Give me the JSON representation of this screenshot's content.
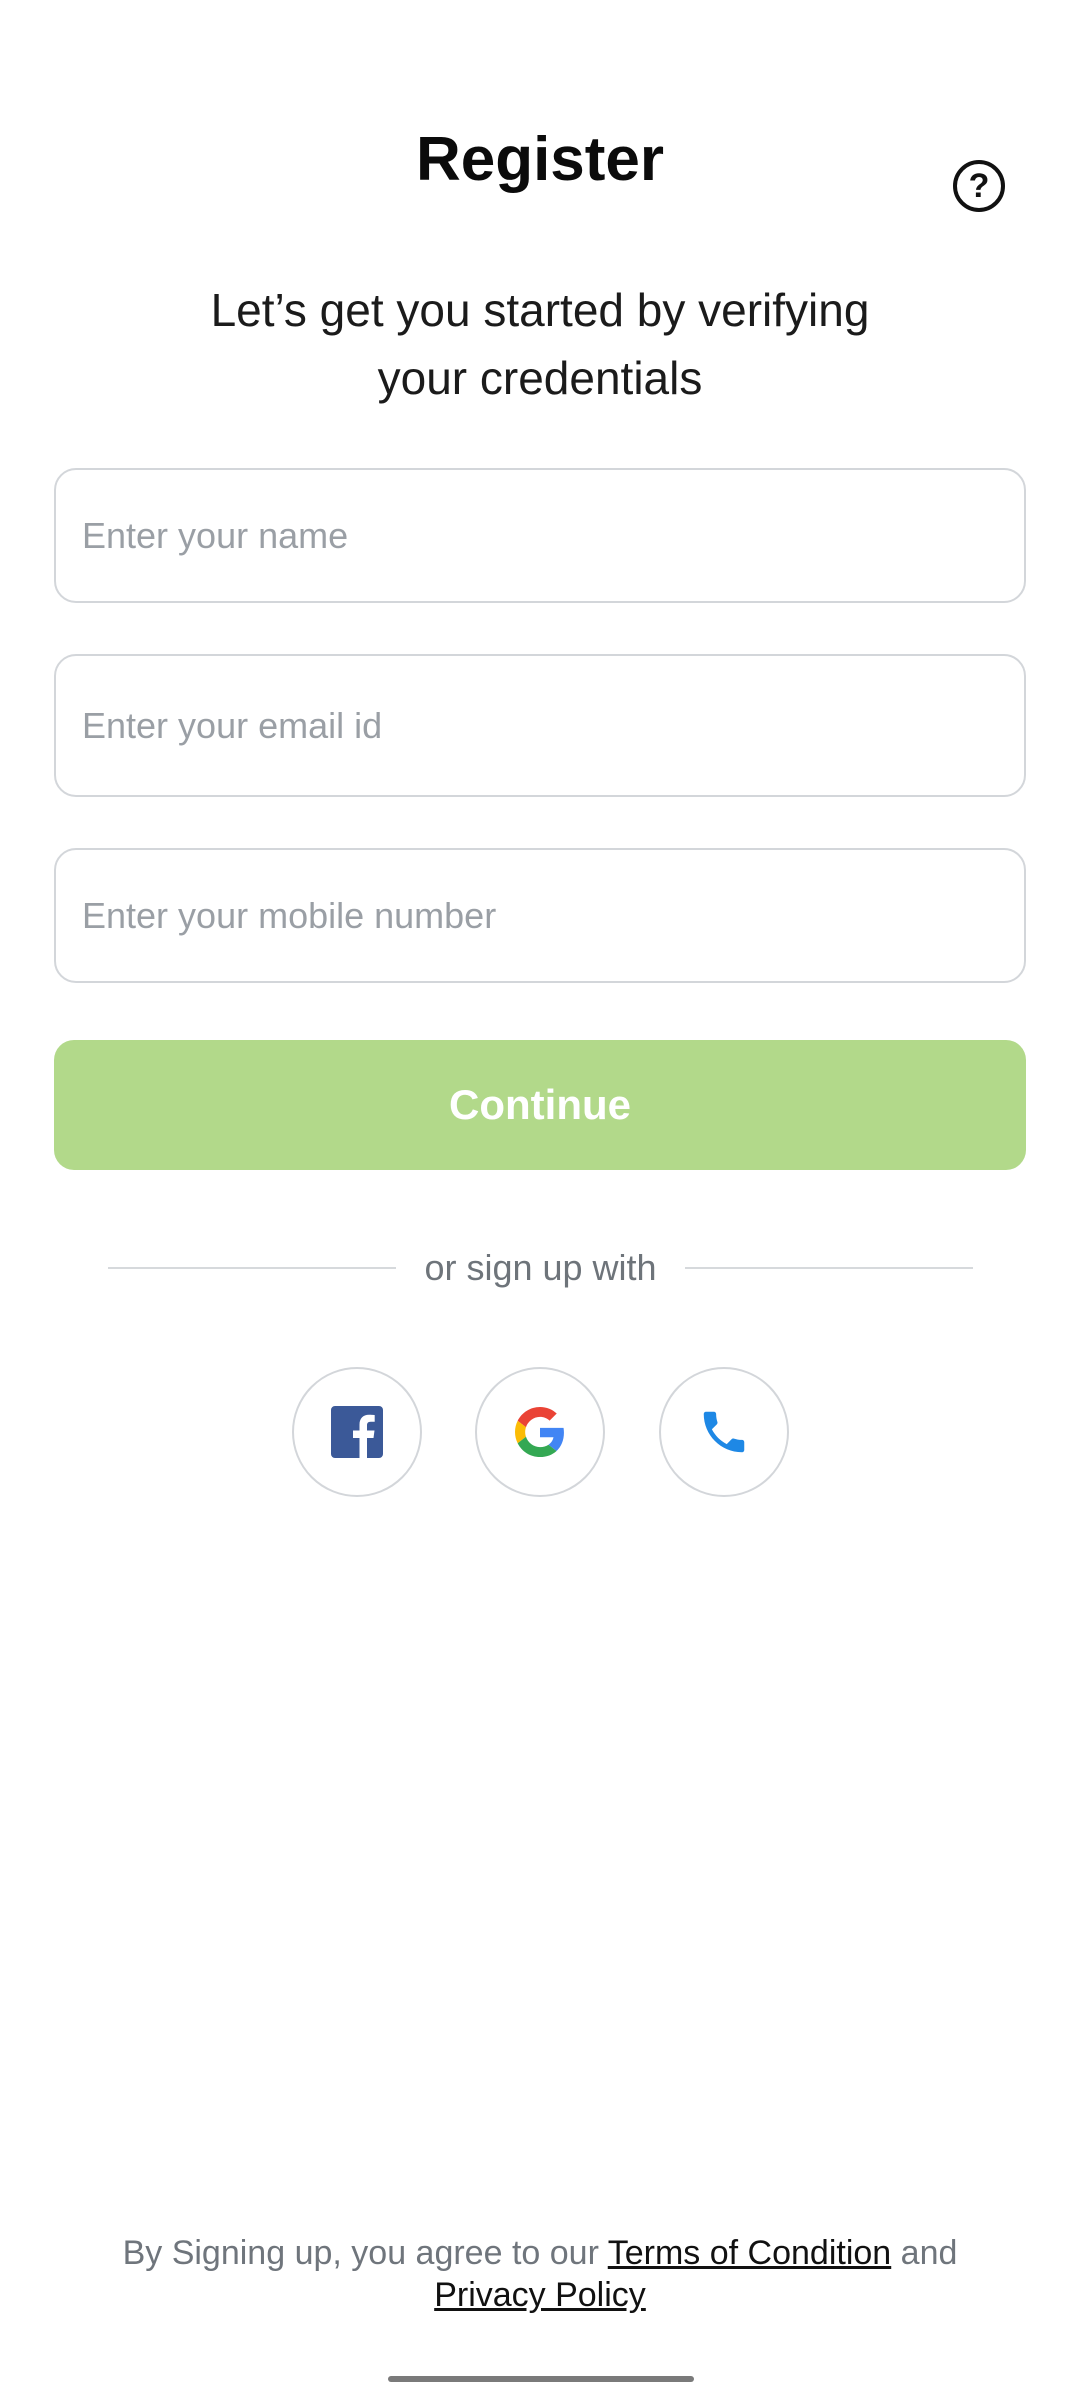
{
  "header": {
    "title": "Register",
    "help_symbol": "?"
  },
  "intro": {
    "line1": "Let’s get you started by verifying",
    "line2": "your credentials"
  },
  "form": {
    "name_placeholder": "Enter your name",
    "email_placeholder": "Enter your email id",
    "mobile_placeholder": "Enter your mobile number",
    "continue_label": "Continue"
  },
  "social": {
    "divider_text": "or sign up with",
    "options": [
      {
        "icon": "facebook-icon"
      },
      {
        "icon": "google-icon"
      },
      {
        "icon": "phone-icon"
      }
    ]
  },
  "footer": {
    "prefix": "By Signing up, you agree to our",
    "terms_link": "Terms of Condition",
    "conjunction": "and",
    "privacy_link": "Privacy Policy"
  },
  "colors": {
    "accent": "#b2d98a",
    "border": "#d3d6da",
    "muted_text": "#6f757c",
    "facebook": "#3b5998",
    "phone": "#1e88e5"
  }
}
